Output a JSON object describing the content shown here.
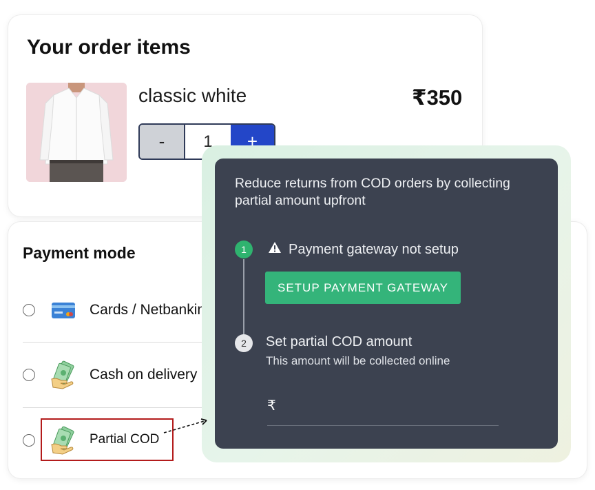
{
  "order": {
    "title": "Your order items",
    "item": {
      "name": "classic white",
      "price": "₹350",
      "quantity": "1",
      "minus_label": "-",
      "plus_label": "+"
    }
  },
  "payment": {
    "title": "Payment mode",
    "options": [
      {
        "label": "Cards / Netbanking",
        "icon": "credit-card-icon"
      },
      {
        "label": "Cash on delivery",
        "icon": "cash-hand-icon"
      },
      {
        "label": "Partial COD",
        "icon": "cash-hand-icon"
      }
    ]
  },
  "popup": {
    "description": "Reduce returns from COD orders by collecting partial amount upfront",
    "step1": {
      "number": "1",
      "warning_icon": "warning-icon",
      "text": "Payment gateway not setup",
      "button_label": "SETUP PAYMENT GATEWAY"
    },
    "step2": {
      "number": "2",
      "title": "Set partial COD amount",
      "subtitle": "This amount will be collected online",
      "currency_prefix": "₹"
    }
  },
  "colors": {
    "plus_button": "#2346c8",
    "popup_bg": "#3c4250",
    "step_active": "#2fb36f",
    "setup_button": "#34b47a",
    "highlight_border": "#b31b1b"
  }
}
